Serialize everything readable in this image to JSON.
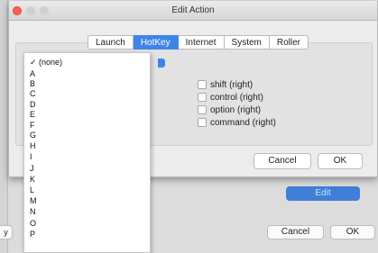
{
  "background_window": {
    "edit_button": "Edit",
    "cancel_button": "Cancel",
    "ok_button": "OK",
    "left_fragment": "y"
  },
  "sheet": {
    "title": "Edit Action",
    "tabs": [
      {
        "label": "Launch"
      },
      {
        "label": "HotKey",
        "active": true
      },
      {
        "label": "Internet"
      },
      {
        "label": "System"
      },
      {
        "label": "Roller"
      }
    ],
    "modifiers": [
      {
        "label": "shift (right)"
      },
      {
        "label": "control (right)"
      },
      {
        "label": "option (right)"
      },
      {
        "label": "command (right)"
      }
    ],
    "cancel_button": "Cancel",
    "ok_button": "OK"
  },
  "key_menu": {
    "items": [
      "✓ (none)",
      "A",
      "B",
      "C",
      "D",
      "E",
      "F",
      "G",
      "H",
      "I",
      "J",
      "K",
      "L",
      "M",
      "N",
      "O",
      "P"
    ]
  },
  "colors": {
    "accent": "#3f85e8",
    "close_button": "#fc5f57"
  }
}
